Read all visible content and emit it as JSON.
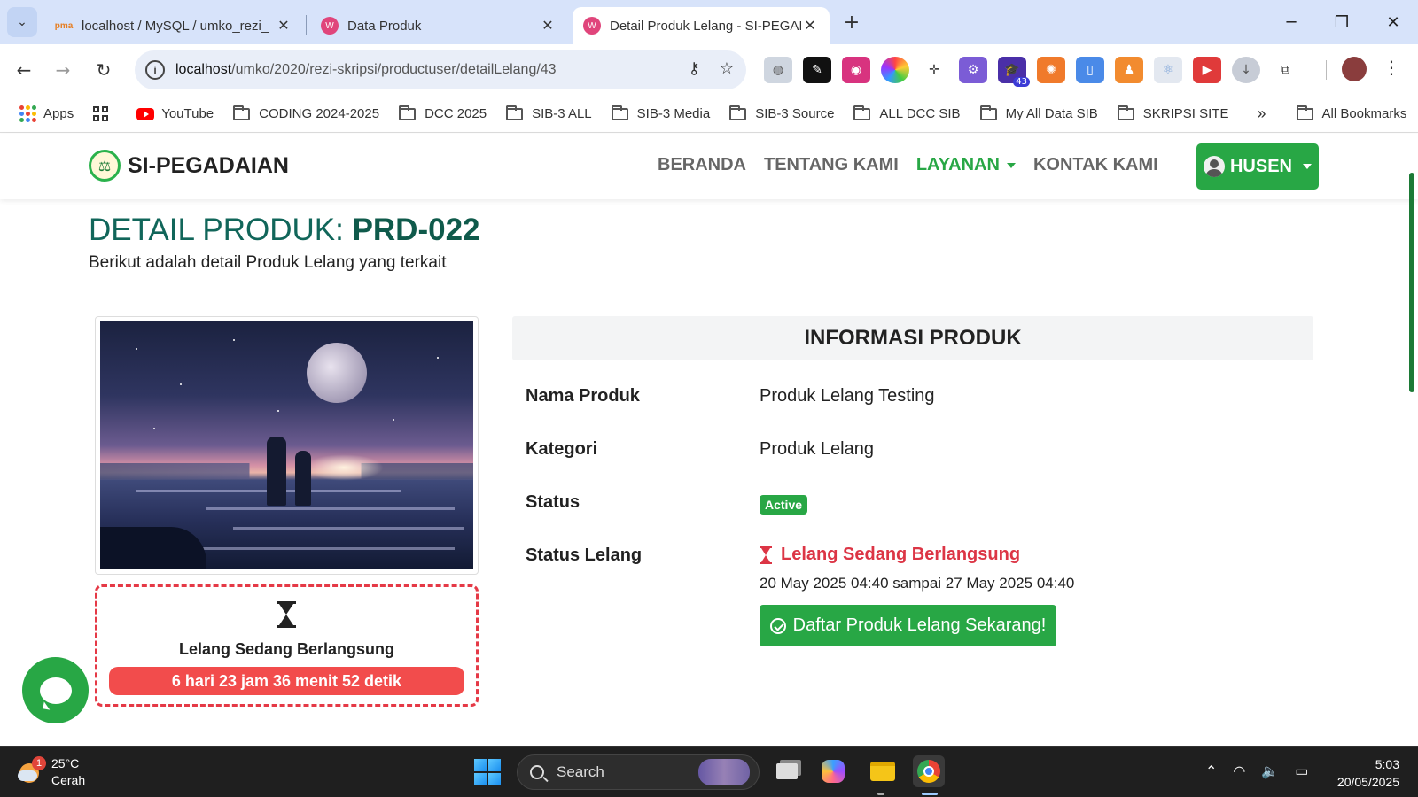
{
  "browser": {
    "tabs": [
      {
        "title": "localhost / MySQL / umko_rezi_",
        "icon": "phpmyadmin-icon",
        "active": false
      },
      {
        "title": "Data Produk",
        "icon": "site-favicon-icon",
        "active": false
      },
      {
        "title": "Detail Produk Lelang - SI-PEGAI",
        "icon": "site-favicon-icon",
        "active": true
      }
    ],
    "url_host": "localhost",
    "url_path": "/umko/2020/rezi-skripsi/productuser/detailLelang/43",
    "extension_badge": "43",
    "bookmarks": [
      {
        "label": "Apps",
        "icon": "apps-icon"
      },
      {
        "label": "YouTube",
        "icon": "youtube-icon"
      },
      {
        "label": "CODING 2024-2025",
        "icon": "folder-icon"
      },
      {
        "label": "DCC 2025",
        "icon": "folder-icon"
      },
      {
        "label": "SIB-3 ALL",
        "icon": "folder-icon"
      },
      {
        "label": "SIB-3 Media",
        "icon": "folder-icon"
      },
      {
        "label": "SIB-3 Source",
        "icon": "folder-icon"
      },
      {
        "label": "ALL DCC SIB",
        "icon": "folder-icon"
      },
      {
        "label": "My All Data SIB",
        "icon": "folder-icon"
      },
      {
        "label": "SKRIPSI SITE",
        "icon": "folder-icon"
      }
    ],
    "bookmarks_overflow": "»",
    "all_bookmarks": "All Bookmarks"
  },
  "site": {
    "brand": "SI-PEGADAIAN",
    "menu": [
      {
        "label": "BERANDA",
        "active": false
      },
      {
        "label": "TENTANG KAMI",
        "active": false
      },
      {
        "label": "LAYANAN",
        "active": true,
        "dropdown": true
      },
      {
        "label": "KONTAK KAMI",
        "active": false
      }
    ],
    "user_label": "HUSEN",
    "accent_color": "#28a745",
    "title_color": "#11665a"
  },
  "page": {
    "title_prefix": "DETAIL PRODUK:",
    "product_code": "PRD-022",
    "subtitle": "Berikut adalah detail Produk Lelang yang terkait",
    "countdown_label": "Lelang Sedang Berlangsung",
    "countdown_timer": "6 hari 23 jam 36 menit 52 detik",
    "info_header": "INFORMASI PRODUK",
    "rows": {
      "nama_label": "Nama Produk",
      "nama_value": "Produk Lelang Testing",
      "kategori_label": "Kategori",
      "kategori_value": "Produk Lelang",
      "status_label": "Status",
      "status_value": "Active",
      "status_lelang_label": "Status Lelang",
      "status_lelang_value": "Lelang Sedang Berlangsung",
      "status_lelang_dates": "20 May 2025 04:40 sampai 27 May 2025 04:40"
    },
    "register_button": "Daftar Produk Lelang Sekarang!"
  },
  "taskbar": {
    "weather_temp": "25°C",
    "weather_desc": "Cerah",
    "weather_badge": "1",
    "search_placeholder": "Search",
    "time": "5:03",
    "date": "20/05/2025"
  }
}
